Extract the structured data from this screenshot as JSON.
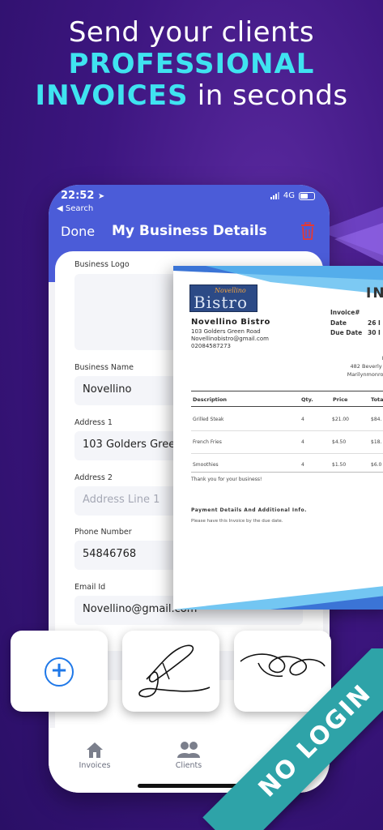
{
  "headline": {
    "line1": "Send your clients",
    "line2": "PROFESSIONAL",
    "line3_highlight": "INVOICES",
    "line3_rest": " in seconds"
  },
  "colors": {
    "background": "#3d1680",
    "accent_cyan": "#3fe3f0",
    "header_blue": "#4b5cd8",
    "delete_red": "#e53935",
    "add_blue": "#1f78e8",
    "ribbon_teal": "#2ea3a8"
  },
  "status_bar": {
    "time": "22:52",
    "back_label": "◀ Search",
    "network": "4G"
  },
  "nav": {
    "done_label": "Done",
    "title": "My Business Details",
    "delete_icon": "trash-icon"
  },
  "form": {
    "logo_label": "Business Logo",
    "business_name_label": "Business Name",
    "business_name_value": "Novellino",
    "address1_label": "Address 1",
    "address1_value": "103 Golders Green",
    "address2_label": "Address 2",
    "address2_placeholder": "Address Line 1",
    "phone_label": "Phone Number",
    "phone_value": "54846768",
    "email_label": "Email Id",
    "email_value": "Novellino@gmail.com"
  },
  "tabbar": {
    "invoices_label": "Invoices",
    "clients_label": "Clients"
  },
  "invoice": {
    "logo_small": "Novellino",
    "logo_big": "Bistro",
    "title": "IN",
    "business_name": "Novellino Bistro",
    "address_lines": [
      "103 Golders Green Road",
      "Novellinobistro@gmail.com",
      "02084587273"
    ],
    "meta_labels": [
      "Invoice#",
      "Date",
      "Due Date"
    ],
    "meta_values": [
      "",
      "26 I",
      "30 I"
    ],
    "client_lines": [
      "Mar",
      "482 Beverly Hill",
      "Marilynmonroe@",
      "+"
    ],
    "columns": [
      "Description",
      "Qty.",
      "Price",
      "Tota"
    ],
    "rows": [
      {
        "description": "Grilled Steak",
        "qty": "4",
        "price": "$21.00",
        "total": "$84."
      },
      {
        "description": "French Fries",
        "qty": "4",
        "price": "$4.50",
        "total": "$18."
      },
      {
        "description": "Smoothies",
        "qty": "4",
        "price": "$1.50",
        "total": "$6.0"
      }
    ],
    "thanks": "Thank you for your business!",
    "payment_title": "Payment Details And Additional Info.",
    "payment_note": "Please have this Invoice by the due date."
  },
  "signatures": {
    "add_icon": "plus-circle-icon"
  },
  "ribbon": {
    "text": "NO LOGIN"
  }
}
